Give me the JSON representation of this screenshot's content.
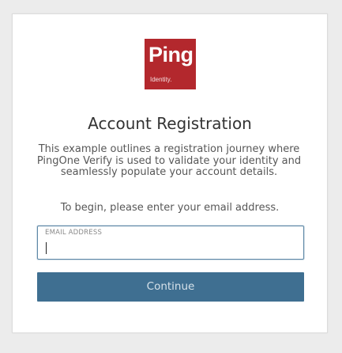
{
  "logo": {
    "word": "Ping",
    "sub": "Identity.",
    "color": "#b3282d"
  },
  "title": "Account Registration",
  "description": "This example outlines a registration journey where PingOne Verify is used to validate your identity and seamlessly populate your account details.",
  "prompt": "To begin, please enter your email address.",
  "email_field": {
    "label": "EMAIL ADDRESS",
    "value": ""
  },
  "continue_button": {
    "label": "Continue",
    "color": "#3f6f91"
  }
}
